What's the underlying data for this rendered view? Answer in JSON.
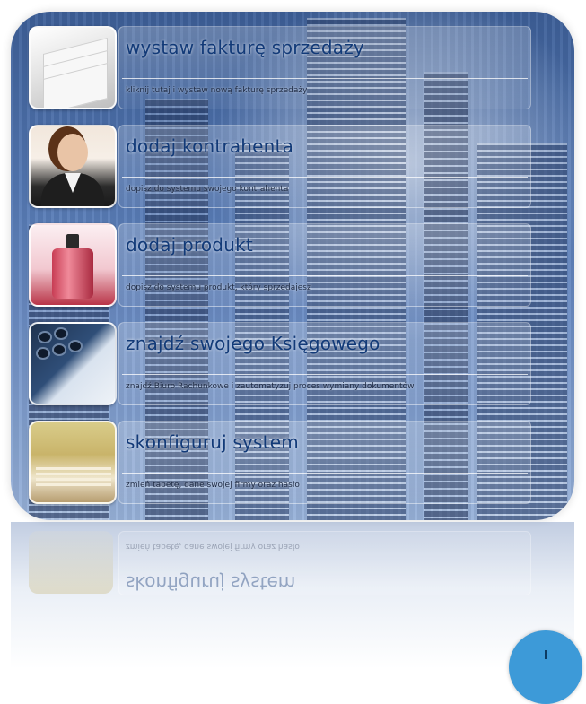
{
  "menu": {
    "items": [
      {
        "title": "wystaw fakturę sprzedaży",
        "desc": "kliknij tutaj i wystaw nową fakturę sprzedaży",
        "icon": "invoice-papers-icon"
      },
      {
        "title": "dodaj kontrahenta",
        "desc": "dopisz do systemu swojego kontrahenta",
        "icon": "contractor-person-icon"
      },
      {
        "title": "dodaj produkt",
        "desc": "dopisz do systemu produkt, który sprzedajesz",
        "icon": "product-perfume-icon"
      },
      {
        "title": "znajdź swojego Księgowego",
        "desc": "znajdź Biuro Rachunkowe i zautomatyzuj proces wymiany dokumentów",
        "icon": "accountant-calculator-icon"
      },
      {
        "title": "skonfiguruj system",
        "desc": "zmień tapetę, dane swojej firmy oraz hasło",
        "icon": "settings-books-icon"
      }
    ]
  },
  "reflection": {
    "title": "skonfiguruj system",
    "desc": "zmień tapetę, dane swojej firmy oraz hasło"
  },
  "colors": {
    "title_text": "#123a78",
    "panel_top": "#3d5f98",
    "panel_bottom": "#98b2d9",
    "corner_button": "#3d9ad8"
  }
}
